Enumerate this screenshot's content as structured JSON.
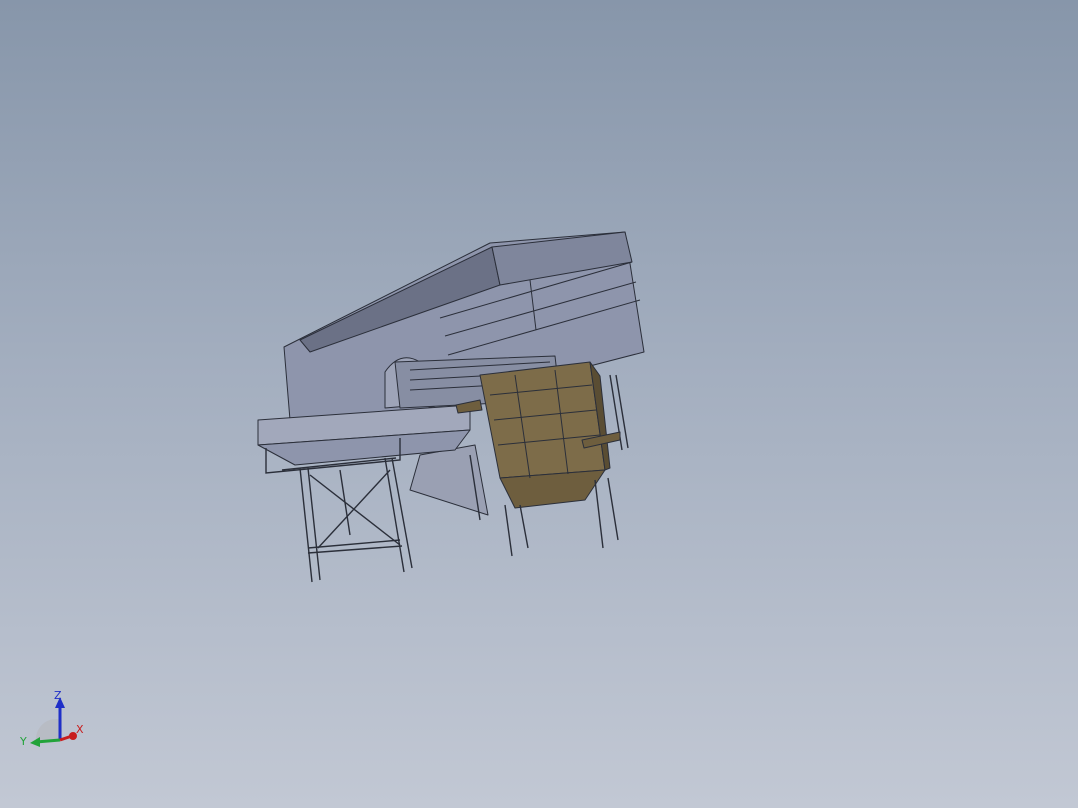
{
  "viewport": {
    "background_top": "#8796aa",
    "background_bottom": "#c2c8d4"
  },
  "model": {
    "hopper_color": "#8e95ac",
    "hopper_shadow": "#6b7186",
    "frame_color": "#2b2f3a",
    "bin_color": "#7d6c49",
    "bin_dark": "#5a4d33"
  },
  "triad": {
    "x_label": "X",
    "y_label": "Y",
    "z_label": "Z",
    "x_color": "#c81e1e",
    "y_color": "#22a33a",
    "z_color": "#1f2fc8"
  }
}
